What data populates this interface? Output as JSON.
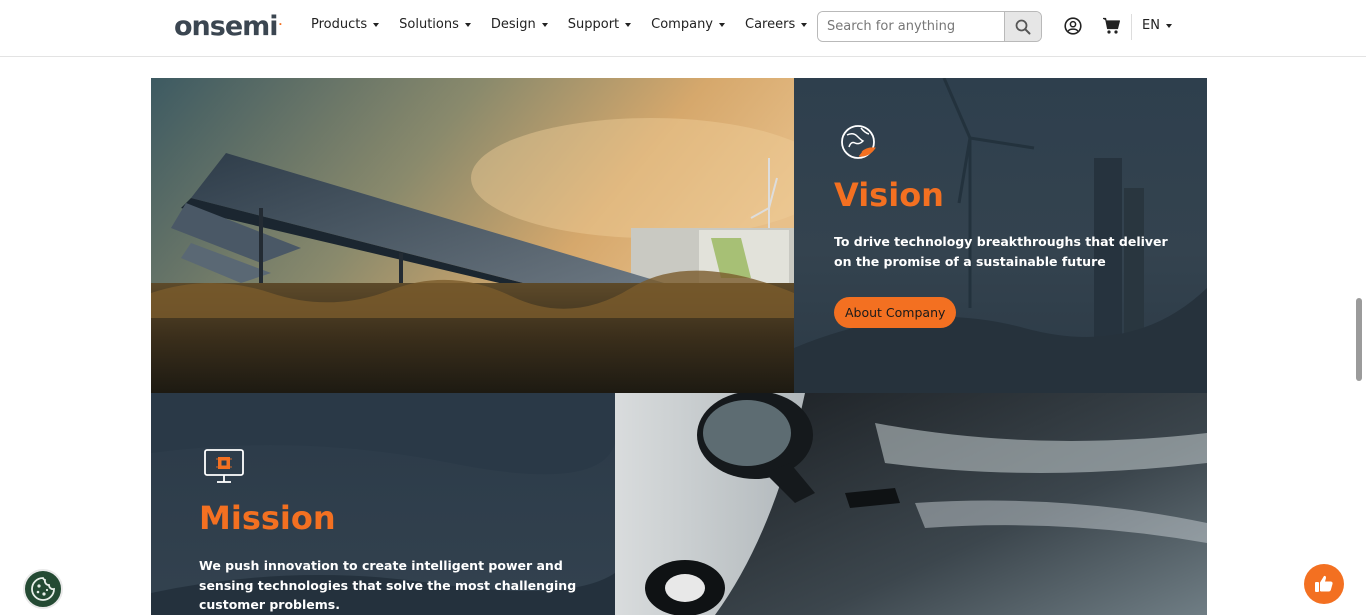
{
  "header": {
    "logo_text": "onsemi",
    "logo_mark": ".",
    "nav": [
      {
        "label": "Products"
      },
      {
        "label": "Solutions"
      },
      {
        "label": "Design"
      },
      {
        "label": "Support"
      },
      {
        "label": "Company"
      },
      {
        "label": "Careers"
      }
    ],
    "search": {
      "placeholder": "Search for anything",
      "icon": "search-icon"
    },
    "account_icon": "user-circle-icon",
    "cart_icon": "cart-icon",
    "language": "EN"
  },
  "vision": {
    "icon": "globe-leaf-icon",
    "title": "Vision",
    "text": "To drive technology breakthroughs that deliver on the promise of a sustainable future",
    "button_label": "About Company"
  },
  "mission": {
    "icon": "monitor-chip-icon",
    "title": "Mission",
    "text": "We push innovation to create intelligent power and sensing technologies that solve the most challenging customer problems."
  },
  "floating": {
    "cookie_icon": "cookie-icon",
    "feedback_icon": "thumbs-up-icon"
  },
  "colors": {
    "accent": "#f37021",
    "panel": "#2f3f4c",
    "cookie_bg": "#244a33"
  }
}
